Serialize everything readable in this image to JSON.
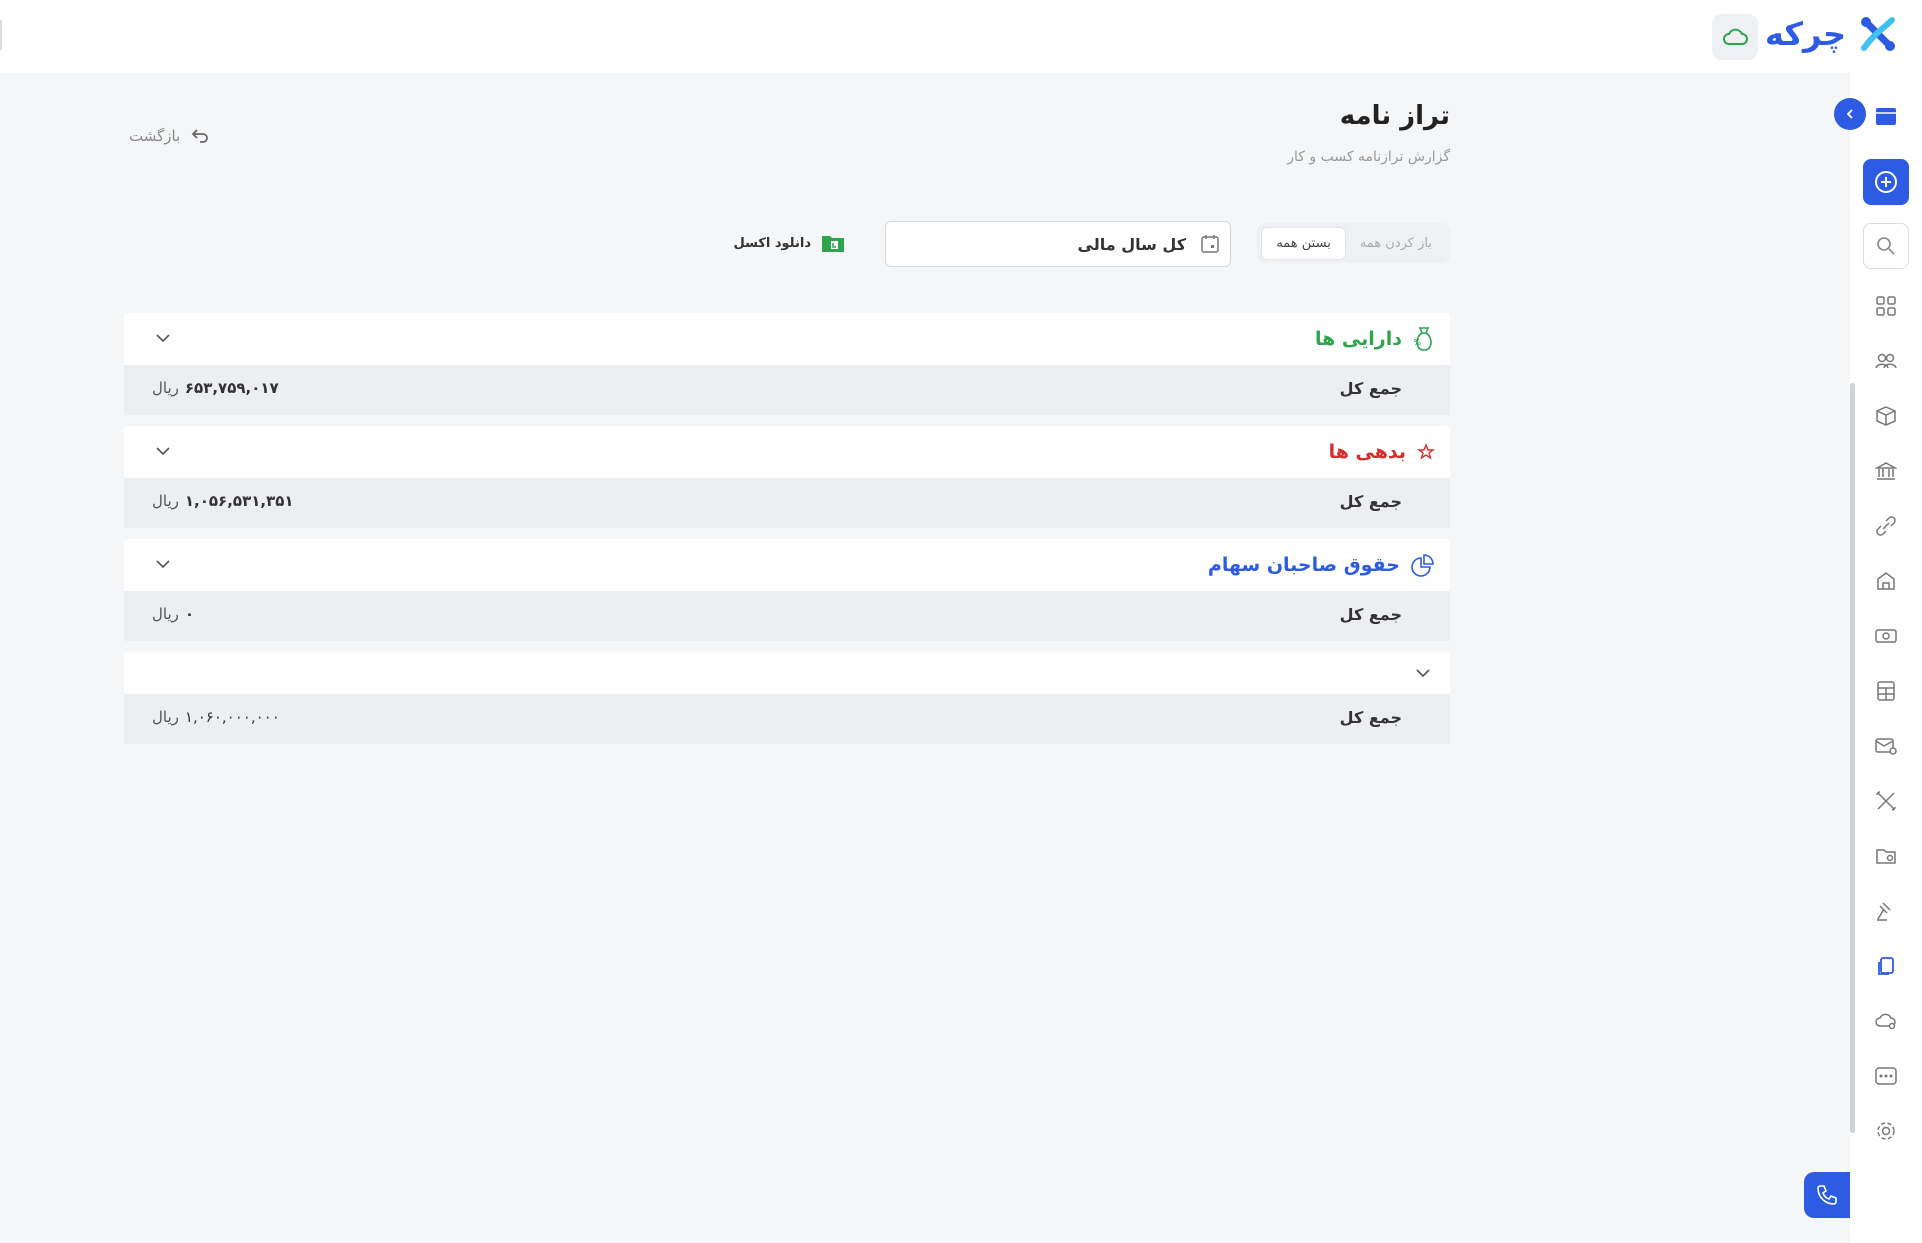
{
  "brand": {
    "name": "چرکه",
    "color": "#2d5be3"
  },
  "header": {
    "cloud_icon": "cloud-icon"
  },
  "page": {
    "title": "تراز نامه",
    "subtitle": "گزارش ترازنامه کسب و کار",
    "back_label": "بازگشت"
  },
  "toolbar": {
    "expand_all": "باز کردن همه",
    "collapse_all": "بستن همه",
    "period_value": "کل سال مالی",
    "excel_label": "دانلود اکسل"
  },
  "sections": [
    {
      "title": "دارایی ها",
      "color": "#2ea44f",
      "total_label": "جمع کل",
      "amount": "۶۵۳,۷۵۹,۰۱۷",
      "currency": "ریال"
    },
    {
      "title": "بدهی ها",
      "color": "#d32f2f",
      "total_label": "جمع کل",
      "amount": "۱,۰۵۶,۵۳۱,۳۵۱",
      "currency": "ریال"
    },
    {
      "title": "حقوق صاحبان سهام",
      "color": "#2d5be3",
      "total_label": "جمع کل",
      "amount": "۰",
      "currency": "ریال"
    },
    {
      "title": "",
      "color": "#333333",
      "total_label": "جمع کل",
      "amount": "۱,۰۶۰,۰۰۰,۰۰۰",
      "currency": "ریال"
    }
  ],
  "colors": {
    "accent": "#2d5be3",
    "excel": "#2ea44f",
    "background": "#f5f6f8"
  }
}
